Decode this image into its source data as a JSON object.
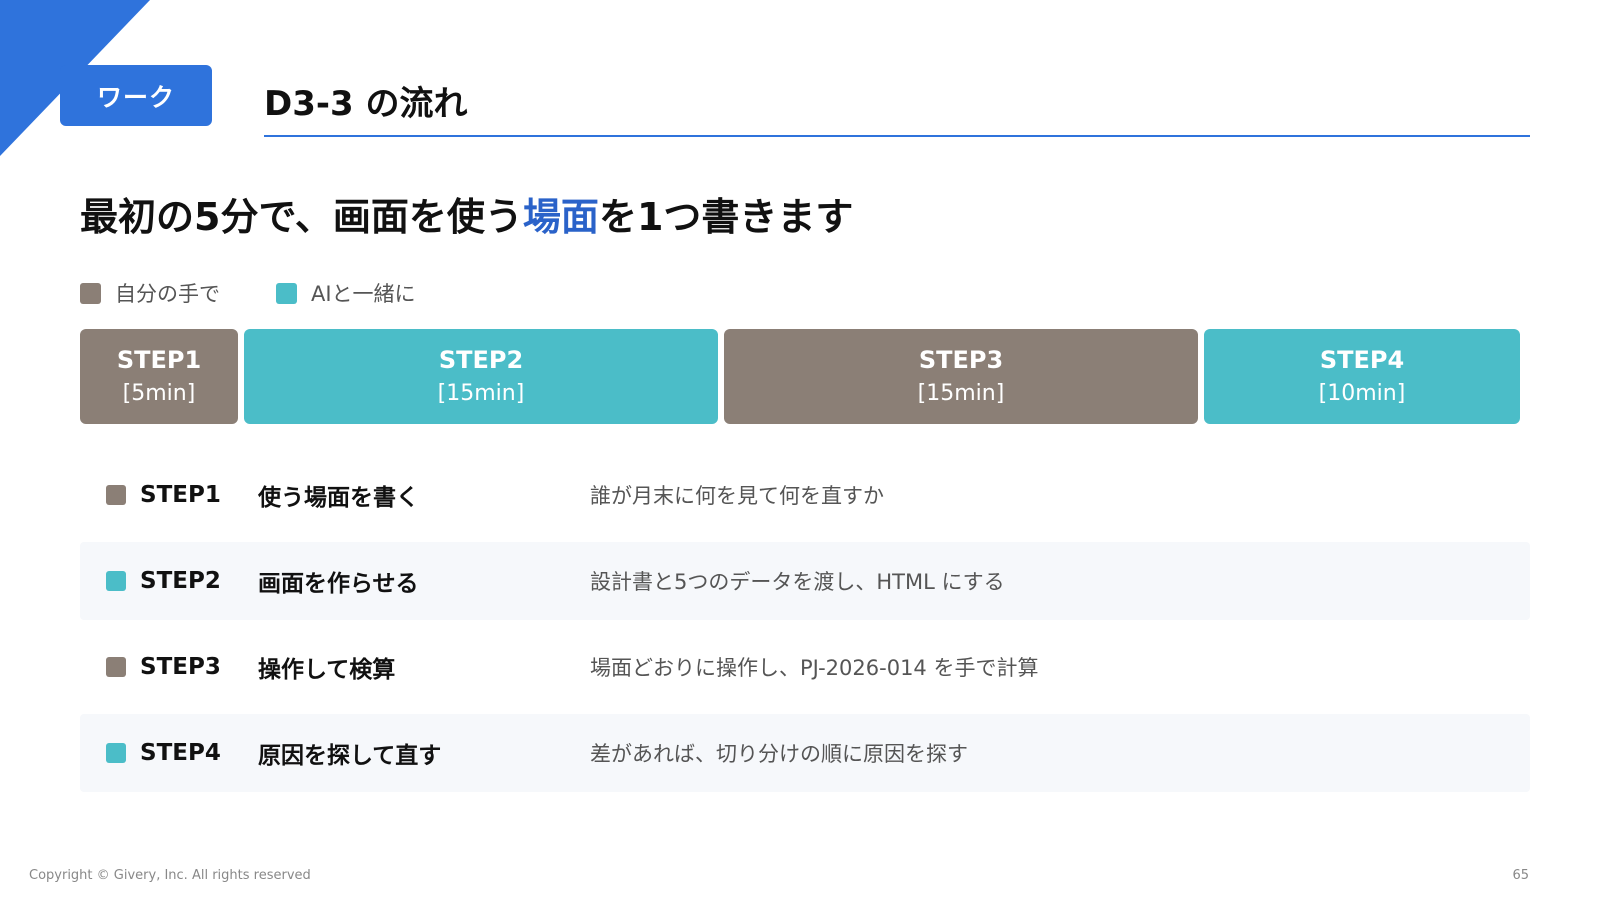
{
  "badge": "ワーク",
  "page_title": "D3-3 の流れ",
  "headline": {
    "before": "最初の5分で、画面を使う",
    "highlight": "場面",
    "after": "を1つ書きます"
  },
  "legend": [
    {
      "label": "自分の手で",
      "color": "#8b7f76"
    },
    {
      "label": "AIと一緒に",
      "color": "#4bbdc8"
    }
  ],
  "timeline": [
    {
      "label": "STEP1",
      "duration": "[5min]",
      "minutes": 5,
      "kind": "self"
    },
    {
      "label": "STEP2",
      "duration": "[15min]",
      "minutes": 15,
      "kind": "ai"
    },
    {
      "label": "STEP3",
      "duration": "[15min]",
      "minutes": 15,
      "kind": "self"
    },
    {
      "label": "STEP4",
      "duration": "[10min]",
      "minutes": 10,
      "kind": "ai"
    }
  ],
  "steps": [
    {
      "id": "STEP1",
      "title": "使う場面を書く",
      "desc": "誰が月末に何を見て何を直すか",
      "kind": "self"
    },
    {
      "id": "STEP2",
      "title": "画面を作らせる",
      "desc": "設計書と5つのデータを渡し、HTML にする",
      "kind": "ai"
    },
    {
      "id": "STEP3",
      "title": "操作して検算",
      "desc": "場面どおりに操作し、PJ-2026-014 を手で計算",
      "kind": "self"
    },
    {
      "id": "STEP4",
      "title": "原因を探して直す",
      "desc": "差があれば、切り分けの順に原因を探す",
      "kind": "ai"
    }
  ],
  "colors": {
    "accent": "#2f73dc",
    "self": "#8b7f76",
    "ai": "#4bbdc8"
  },
  "footer": {
    "copyright": "Copyright © Givery, Inc. All rights reserved",
    "page": "65"
  }
}
